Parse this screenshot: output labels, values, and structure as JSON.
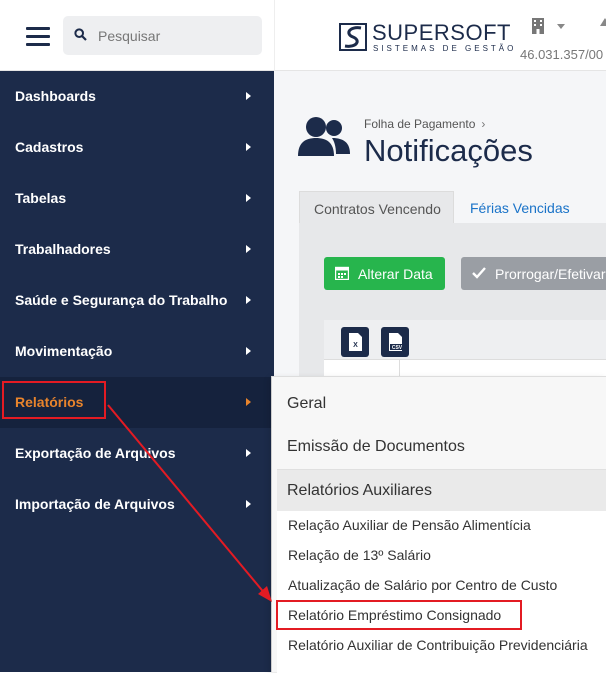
{
  "search": {
    "placeholder": "Pesquisar"
  },
  "brand": {
    "name": "SUPERSOFT",
    "subtitle": "SISTEMAS DE GESTÃO"
  },
  "company": {
    "cnpj": "46.031.357/00"
  },
  "sidebar": {
    "items": [
      {
        "label": "Dashboards"
      },
      {
        "label": "Cadastros"
      },
      {
        "label": "Tabelas"
      },
      {
        "label": "Trabalhadores"
      },
      {
        "label": "Saúde e Segurança do Trabalho"
      },
      {
        "label": "Movimentação"
      },
      {
        "label": "Relatórios",
        "active": true
      },
      {
        "label": "Exportação de Arquivos"
      },
      {
        "label": "Importação de Arquivos"
      }
    ]
  },
  "main": {
    "breadcrumb": "Folha de Pagamento",
    "title": "Notificações",
    "tabs": [
      {
        "label": "Contratos Vencendo",
        "active": true
      },
      {
        "label": "Férias Vencidas"
      }
    ],
    "buttons": {
      "alterar_data": "Alterar Data",
      "prorrogar": "Prorrogar/Efetivar"
    },
    "export": {
      "xls": "X",
      "csv": "CSV"
    }
  },
  "dropdown": {
    "headers": [
      "Geral",
      "Emissão de Documentos",
      "Relatórios Auxiliares"
    ],
    "items": [
      "Relação Auxiliar de Pensão Alimentícia",
      "Relação de 13º Salário",
      "Atualização de Salário por Centro de Custo",
      "Relatório Empréstimo Consignado",
      "Relatório Auxiliar de Contribuição Previdenciária"
    ]
  },
  "colors": {
    "sidebar_bg": "#1c2b4a",
    "active_accent": "#e8842c",
    "highlight_red": "#e31b23",
    "green_button": "#27b54d",
    "link_blue": "#1a73c8"
  }
}
